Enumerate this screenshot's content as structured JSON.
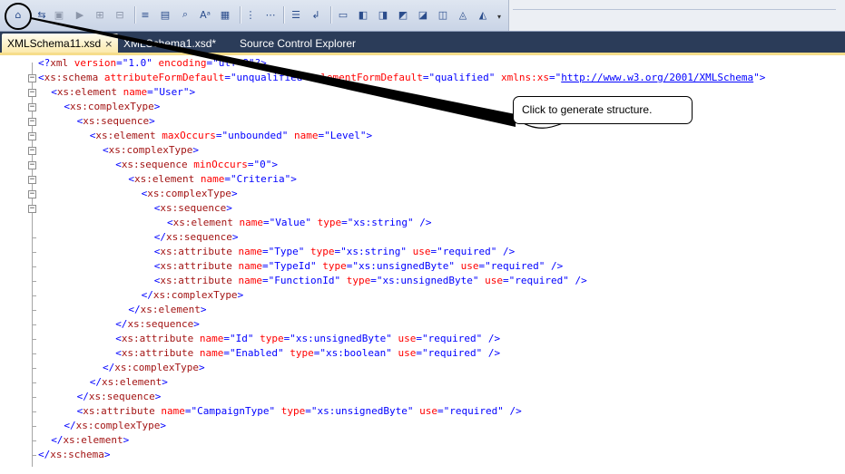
{
  "toolbar": {
    "buttons": [
      {
        "name": "generate-structure-icon"
      },
      {
        "name": "show-schema-icon"
      },
      {
        "name": "validate-icon"
      },
      {
        "name": "go-to-definition-icon"
      },
      {
        "name": "create-schema-icon"
      },
      {
        "name": "xslt-debug-icon"
      },
      {
        "name": "indent-icon"
      },
      {
        "name": "format-icon"
      },
      {
        "name": "find-icon"
      },
      {
        "name": "bookmark-icon"
      },
      {
        "name": "comment-icon"
      },
      {
        "name": "uncomment-icon"
      },
      {
        "name": "outdent-icon"
      },
      {
        "name": "list-icon"
      },
      {
        "name": "line-break-icon"
      },
      {
        "name": "rectangle-icon"
      },
      {
        "name": "bookmark-prev-icon"
      },
      {
        "name": "bookmark-next-icon"
      },
      {
        "name": "bookmark-folder-prev-icon"
      },
      {
        "name": "bookmark-folder-next-icon"
      },
      {
        "name": "bookmark-doc-prev-icon"
      },
      {
        "name": "bookmark-doc-next-icon"
      },
      {
        "name": "clear-bookmarks-icon"
      }
    ],
    "dropdown_glyph": "▾"
  },
  "tabs": [
    {
      "label": "XMLSchema11.xsd",
      "close": "×",
      "active": true
    },
    {
      "label": "XMLSchema1.xsd*",
      "active": false
    },
    {
      "label": "Source Control Explorer",
      "active": false
    }
  ],
  "callout": {
    "text": "Click to generate structure."
  },
  "code": [
    {
      "indent": 0,
      "fold": "none",
      "tokens": [
        [
          "br",
          "<?"
        ],
        [
          "tag",
          "xml"
        ],
        [
          "attr",
          " version"
        ],
        [
          "br",
          "="
        ],
        [
          "val",
          "\"1.0\""
        ],
        [
          "attr",
          " encoding"
        ],
        [
          "br",
          "="
        ],
        [
          "val",
          "\"utf-8\""
        ],
        [
          "br",
          "?>"
        ]
      ]
    },
    {
      "indent": 0,
      "fold": "open",
      "tokens": [
        [
          "br",
          "<"
        ],
        [
          "tag",
          "xs:schema"
        ],
        [
          "attr",
          " attributeFormDefault"
        ],
        [
          "br",
          "="
        ],
        [
          "val",
          "\"unqualified\""
        ],
        [
          "attr",
          " elementFormDefault"
        ],
        [
          "br",
          "="
        ],
        [
          "val",
          "\"qualified\""
        ],
        [
          "attr",
          " xmlns:xs"
        ],
        [
          "br",
          "="
        ],
        [
          "val",
          "\""
        ],
        [
          "link",
          "http://www.w3.org/2001/XMLSchema"
        ],
        [
          "val",
          "\""
        ],
        [
          "br",
          ">"
        ]
      ]
    },
    {
      "indent": 1,
      "fold": "open",
      "tokens": [
        [
          "br",
          "<"
        ],
        [
          "tag",
          "xs:element"
        ],
        [
          "attr",
          " name"
        ],
        [
          "br",
          "="
        ],
        [
          "val",
          "\"User\""
        ],
        [
          "br",
          ">"
        ]
      ]
    },
    {
      "indent": 2,
      "fold": "open",
      "tokens": [
        [
          "br",
          "<"
        ],
        [
          "tag",
          "xs:complexType"
        ],
        [
          "br",
          ">"
        ]
      ]
    },
    {
      "indent": 3,
      "fold": "open",
      "tokens": [
        [
          "br",
          "<"
        ],
        [
          "tag",
          "xs:sequence"
        ],
        [
          "br",
          ">"
        ]
      ]
    },
    {
      "indent": 4,
      "fold": "open",
      "tokens": [
        [
          "br",
          "<"
        ],
        [
          "tag",
          "xs:element"
        ],
        [
          "attr",
          " maxOccurs"
        ],
        [
          "br",
          "="
        ],
        [
          "val",
          "\"unbounded\""
        ],
        [
          "attr",
          " name"
        ],
        [
          "br",
          "="
        ],
        [
          "val",
          "\"Level\""
        ],
        [
          "br",
          ">"
        ]
      ]
    },
    {
      "indent": 5,
      "fold": "open",
      "tokens": [
        [
          "br",
          "<"
        ],
        [
          "tag",
          "xs:complexType"
        ],
        [
          "br",
          ">"
        ]
      ]
    },
    {
      "indent": 6,
      "fold": "open",
      "tokens": [
        [
          "br",
          "<"
        ],
        [
          "tag",
          "xs:sequence"
        ],
        [
          "attr",
          " minOccurs"
        ],
        [
          "br",
          "="
        ],
        [
          "val",
          "\"0\""
        ],
        [
          "br",
          ">"
        ]
      ]
    },
    {
      "indent": 7,
      "fold": "open",
      "tokens": [
        [
          "br",
          "<"
        ],
        [
          "tag",
          "xs:element"
        ],
        [
          "attr",
          " name"
        ],
        [
          "br",
          "="
        ],
        [
          "val",
          "\"Criteria\""
        ],
        [
          "br",
          ">"
        ]
      ]
    },
    {
      "indent": 8,
      "fold": "open",
      "tokens": [
        [
          "br",
          "<"
        ],
        [
          "tag",
          "xs:complexType"
        ],
        [
          "br",
          ">"
        ]
      ]
    },
    {
      "indent": 9,
      "fold": "open",
      "tokens": [
        [
          "br",
          "<"
        ],
        [
          "tag",
          "xs:sequence"
        ],
        [
          "br",
          ">"
        ]
      ]
    },
    {
      "indent": 10,
      "fold": "none",
      "tokens": [
        [
          "br",
          "<"
        ],
        [
          "tag",
          "xs:element"
        ],
        [
          "attr",
          " name"
        ],
        [
          "br",
          "="
        ],
        [
          "val",
          "\"Value\""
        ],
        [
          "attr",
          " type"
        ],
        [
          "br",
          "="
        ],
        [
          "val",
          "\"xs:string\""
        ],
        [
          "br",
          " />"
        ]
      ]
    },
    {
      "indent": 9,
      "fold": "end",
      "tokens": [
        [
          "br",
          "</"
        ],
        [
          "tag",
          "xs:sequence"
        ],
        [
          "br",
          ">"
        ]
      ]
    },
    {
      "indent": 9,
      "fold": "end",
      "tokens": [
        [
          "br",
          "<"
        ],
        [
          "tag",
          "xs:attribute"
        ],
        [
          "attr",
          " name"
        ],
        [
          "br",
          "="
        ],
        [
          "val",
          "\"Type\""
        ],
        [
          "attr",
          " type"
        ],
        [
          "br",
          "="
        ],
        [
          "val",
          "\"xs:string\""
        ],
        [
          "attr",
          " use"
        ],
        [
          "br",
          "="
        ],
        [
          "val",
          "\"required\""
        ],
        [
          "br",
          " />"
        ]
      ]
    },
    {
      "indent": 9,
      "fold": "end",
      "tokens": [
        [
          "br",
          "<"
        ],
        [
          "tag",
          "xs:attribute"
        ],
        [
          "attr",
          " name"
        ],
        [
          "br",
          "="
        ],
        [
          "val",
          "\"TypeId\""
        ],
        [
          "attr",
          " type"
        ],
        [
          "br",
          "="
        ],
        [
          "val",
          "\"xs:unsignedByte\""
        ],
        [
          "attr",
          " use"
        ],
        [
          "br",
          "="
        ],
        [
          "val",
          "\"required\""
        ],
        [
          "br",
          " />"
        ]
      ]
    },
    {
      "indent": 9,
      "fold": "end",
      "tokens": [
        [
          "br",
          "<"
        ],
        [
          "tag",
          "xs:attribute"
        ],
        [
          "attr",
          " name"
        ],
        [
          "br",
          "="
        ],
        [
          "val",
          "\"FunctionId\""
        ],
        [
          "attr",
          " type"
        ],
        [
          "br",
          "="
        ],
        [
          "val",
          "\"xs:unsignedByte\""
        ],
        [
          "attr",
          " use"
        ],
        [
          "br",
          "="
        ],
        [
          "val",
          "\"required\""
        ],
        [
          "br",
          " />"
        ]
      ]
    },
    {
      "indent": 8,
      "fold": "end",
      "tokens": [
        [
          "br",
          "</"
        ],
        [
          "tag",
          "xs:complexType"
        ],
        [
          "br",
          ">"
        ]
      ]
    },
    {
      "indent": 7,
      "fold": "end",
      "tokens": [
        [
          "br",
          "</"
        ],
        [
          "tag",
          "xs:element"
        ],
        [
          "br",
          ">"
        ]
      ]
    },
    {
      "indent": 6,
      "fold": "end",
      "tokens": [
        [
          "br",
          "</"
        ],
        [
          "tag",
          "xs:sequence"
        ],
        [
          "br",
          ">"
        ]
      ]
    },
    {
      "indent": 6,
      "fold": "end",
      "tokens": [
        [
          "br",
          "<"
        ],
        [
          "tag",
          "xs:attribute"
        ],
        [
          "attr",
          " name"
        ],
        [
          "br",
          "="
        ],
        [
          "val",
          "\"Id\""
        ],
        [
          "attr",
          " type"
        ],
        [
          "br",
          "="
        ],
        [
          "val",
          "\"xs:unsignedByte\""
        ],
        [
          "attr",
          " use"
        ],
        [
          "br",
          "="
        ],
        [
          "val",
          "\"required\""
        ],
        [
          "br",
          " />"
        ]
      ]
    },
    {
      "indent": 6,
      "fold": "end",
      "tokens": [
        [
          "br",
          "<"
        ],
        [
          "tag",
          "xs:attribute"
        ],
        [
          "attr",
          " name"
        ],
        [
          "br",
          "="
        ],
        [
          "val",
          "\"Enabled\""
        ],
        [
          "attr",
          " type"
        ],
        [
          "br",
          "="
        ],
        [
          "val",
          "\"xs:boolean\""
        ],
        [
          "attr",
          " use"
        ],
        [
          "br",
          "="
        ],
        [
          "val",
          "\"required\""
        ],
        [
          "br",
          " />"
        ]
      ]
    },
    {
      "indent": 5,
      "fold": "end",
      "tokens": [
        [
          "br",
          "</"
        ],
        [
          "tag",
          "xs:complexType"
        ],
        [
          "br",
          ">"
        ]
      ]
    },
    {
      "indent": 4,
      "fold": "end",
      "tokens": [
        [
          "br",
          "</"
        ],
        [
          "tag",
          "xs:element"
        ],
        [
          "br",
          ">"
        ]
      ]
    },
    {
      "indent": 3,
      "fold": "end",
      "tokens": [
        [
          "br",
          "</"
        ],
        [
          "tag",
          "xs:sequence"
        ],
        [
          "br",
          ">"
        ]
      ]
    },
    {
      "indent": 3,
      "fold": "end",
      "tokens": [
        [
          "br",
          "<"
        ],
        [
          "tag",
          "xs:attribute"
        ],
        [
          "attr",
          " name"
        ],
        [
          "br",
          "="
        ],
        [
          "val",
          "\"CampaignType\""
        ],
        [
          "attr",
          " type"
        ],
        [
          "br",
          "="
        ],
        [
          "val",
          "\"xs:unsignedByte\""
        ],
        [
          "attr",
          " use"
        ],
        [
          "br",
          "="
        ],
        [
          "val",
          "\"required\""
        ],
        [
          "br",
          " />"
        ]
      ]
    },
    {
      "indent": 2,
      "fold": "end",
      "tokens": [
        [
          "br",
          "</"
        ],
        [
          "tag",
          "xs:complexType"
        ],
        [
          "br",
          ">"
        ]
      ]
    },
    {
      "indent": 1,
      "fold": "end",
      "tokens": [
        [
          "br",
          "</"
        ],
        [
          "tag",
          "xs:element"
        ],
        [
          "br",
          ">"
        ]
      ]
    },
    {
      "indent": 0,
      "fold": "end",
      "tokens": [
        [
          "br",
          "</"
        ],
        [
          "tag",
          "xs:schema"
        ],
        [
          "br",
          ">"
        ]
      ]
    }
  ]
}
